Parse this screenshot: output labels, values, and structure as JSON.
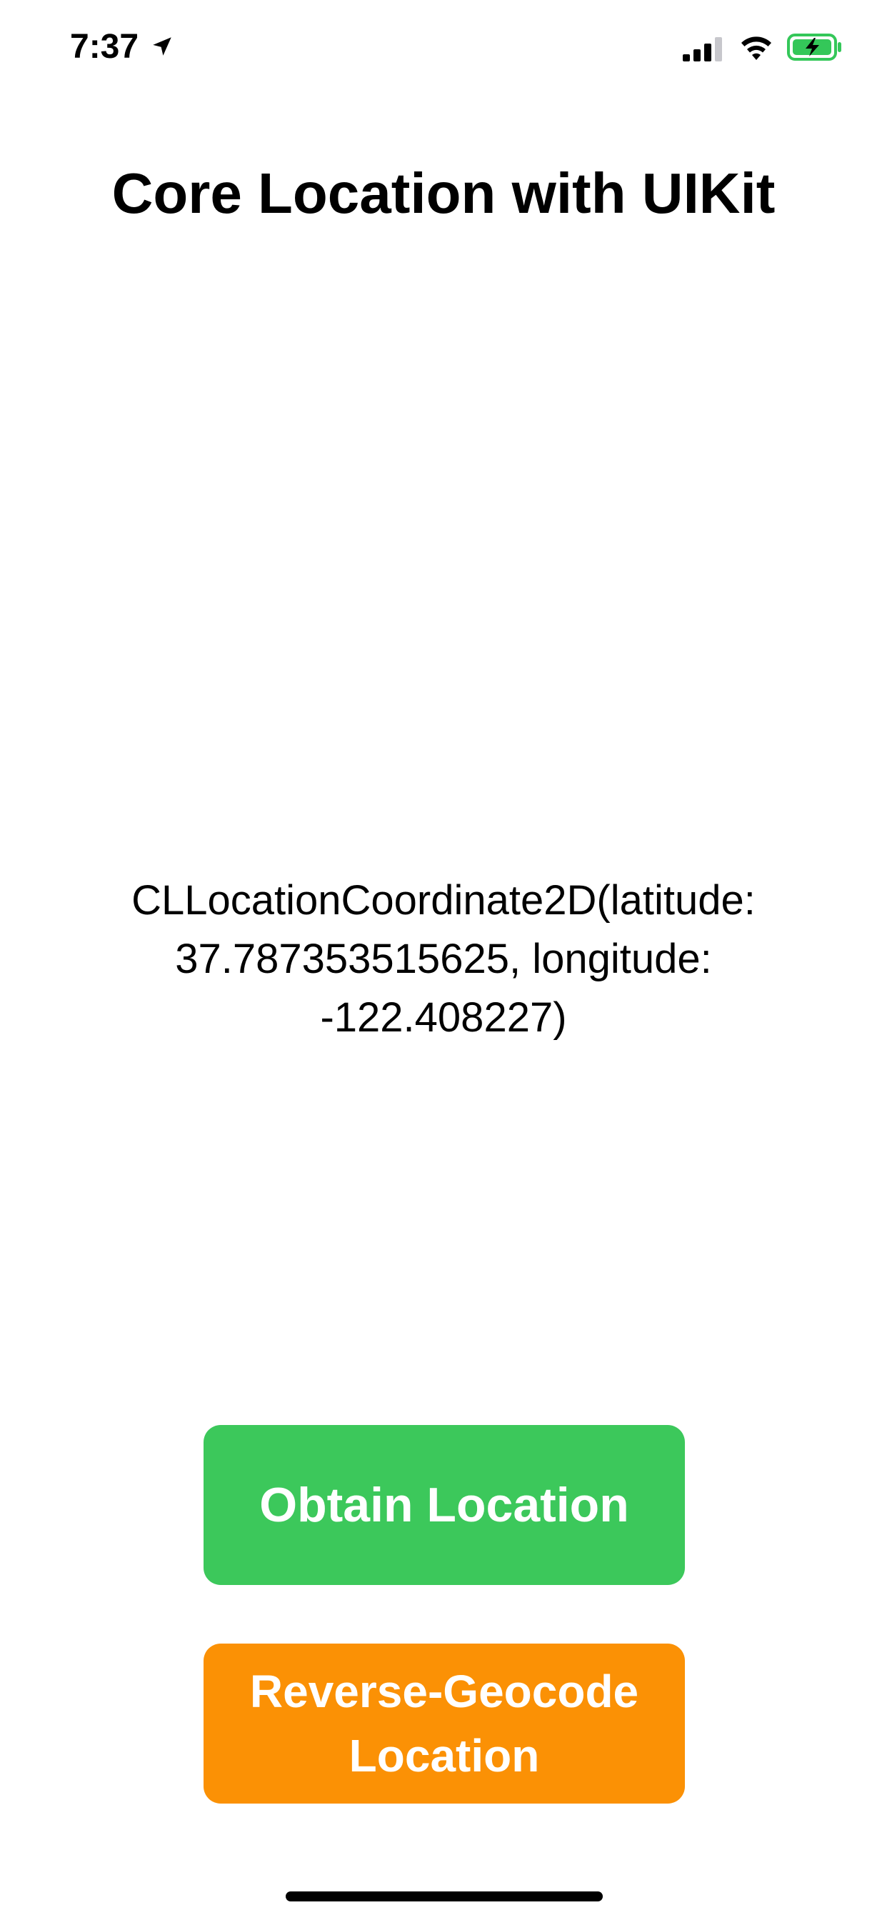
{
  "status_bar": {
    "time": "7:37",
    "icons": {
      "location": "location-arrow-icon",
      "signal": "cellular-signal-icon",
      "wifi": "wifi-icon",
      "battery": "battery-charging-icon"
    },
    "battery_color": "#34c759"
  },
  "header": {
    "title": "Core Location with UIKit"
  },
  "main": {
    "coordinate_text": "CLLocationCoordinate2D(latitude: 37.787353515625, longitude: -122.408227)"
  },
  "buttons": {
    "obtain_label": "Obtain Location",
    "obtain_color": "#3cc85b",
    "reverse_label": "Reverse-Geocode Location",
    "reverse_color": "#fb9105"
  }
}
